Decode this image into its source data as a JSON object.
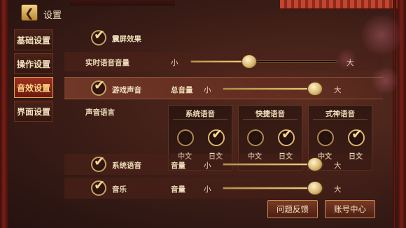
{
  "header": {
    "title": "设置"
  },
  "sidebar": {
    "items": [
      {
        "label": "基础设置"
      },
      {
        "label": "操作设置"
      },
      {
        "label": "音效设置"
      },
      {
        "label": "界面设置"
      }
    ]
  },
  "settings": {
    "shake": {
      "label": "震屏效果",
      "checked": true
    },
    "realtime_voice": {
      "label": "实时语音音量",
      "min_label": "小",
      "max_label": "大",
      "value": 0.4
    },
    "game_sound": {
      "label": "游戏声音",
      "checked": true,
      "sub_label": "总音量",
      "min_label": "小",
      "max_label": "大",
      "value": 0.99
    },
    "voice_language": {
      "label": "声音语言",
      "groups": [
        {
          "title": "系统语音",
          "options": [
            {
              "label": "中文",
              "selected": false
            },
            {
              "label": "日文",
              "selected": true
            }
          ]
        },
        {
          "title": "快捷语音",
          "options": [
            {
              "label": "中文",
              "selected": false
            },
            {
              "label": "日文",
              "selected": true
            }
          ]
        },
        {
          "title": "式神语音",
          "options": [
            {
              "label": "中文",
              "selected": false
            },
            {
              "label": "日文",
              "selected": true
            }
          ]
        }
      ]
    },
    "system_voice": {
      "label": "系统语音",
      "checked": true,
      "sub_label": "音量",
      "min_label": "小",
      "max_label": "大",
      "value": 0.99
    },
    "music": {
      "label": "音乐",
      "checked": true,
      "sub_label": "音量",
      "min_label": "小",
      "max_label": "大",
      "value": 0.99
    }
  },
  "buttons": {
    "feedback": "问题反馈",
    "account": "账号中心"
  }
}
